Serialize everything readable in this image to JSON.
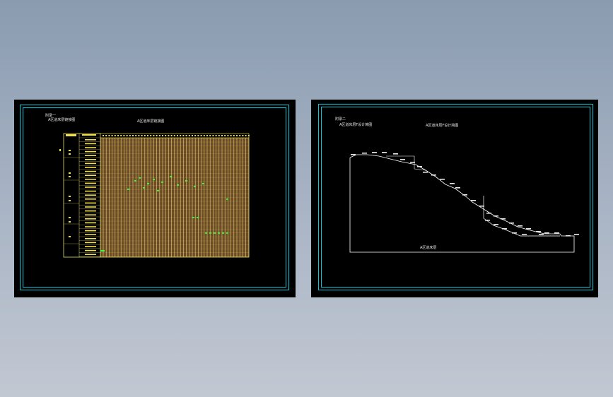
{
  "colors": {
    "background_top": "#8a9bb0",
    "background_bottom": "#c2c8d2",
    "sheet": "#000000",
    "frame": "#00c8d8",
    "table_line": "#e8e060",
    "table_fill": "#6b4a2a",
    "highlight": "#3aff3a",
    "profile_line": "#ffffff"
  },
  "left_sheet": {
    "corner_label_1": "附录一",
    "corner_label_2": "A区道床层链接图",
    "center_title": "A区道床层链接图"
  },
  "right_sheet": {
    "corner_label_1": "附录二",
    "corner_label_2": "A区道床层F设计简图",
    "center_title": "A区道床层F设计简图",
    "bottom_label": "A区道床层"
  }
}
